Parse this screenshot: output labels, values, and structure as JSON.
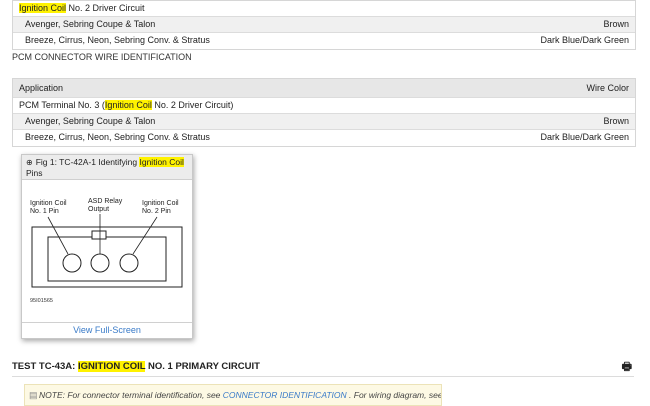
{
  "table1": {
    "top_row": {
      "pre": "",
      "highlight": "Ignition Coil",
      "post": " No. 2 Driver Circuit"
    },
    "rows": [
      {
        "label": "Avenger, Sebring Coupe & Talon",
        "value": "Brown"
      },
      {
        "label": "Breeze, Cirrus, Neon, Sebring Conv. & Stratus",
        "value": "Dark Blue/Dark Green"
      }
    ]
  },
  "section_label": "PCM CONNECTOR WIRE IDENTIFICATION",
  "table2": {
    "header_left": "Application",
    "header_right": "Wire Color",
    "group_row": {
      "pre": "PCM Terminal No. 3 (",
      "highlight": "Ignition Coil",
      "post": " No. 2 Driver Circuit)"
    },
    "rows": [
      {
        "label": "Avenger, Sebring Coupe & Talon",
        "value": "Brown"
      },
      {
        "label": "Breeze, Cirrus, Neon, Sebring Conv. & Stratus",
        "value": "Dark Blue/Dark Green"
      }
    ]
  },
  "figure": {
    "title_pre": "Fig 1: TC-42A-1 Identifying ",
    "title_highlight": "Ignition Coil",
    "title_post": "Pins",
    "label_left_1": "Ignition Coil",
    "label_left_2": "No. 1 Pin",
    "label_mid_1": "ASD Relay",
    "label_mid_2": "Output",
    "label_right_1": "Ignition Coil",
    "label_right_2": "No. 2 Pin",
    "code": "95I01565",
    "link": "View Full-Screen",
    "icon": "magnifier-plus-icon"
  },
  "test": {
    "pre": "TEST TC-43A: ",
    "highlight": "IGNITION COIL",
    "post": " NO. 1 PRIMARY CIRCUIT",
    "print_icon": "printer-icon"
  },
  "note": {
    "icon": "note-icon",
    "text_pre": "NOTE: For connector terminal identification, see ",
    "link": "CONNECTOR IDENTIFICATION",
    "text_post": " . For wiring diagram, see"
  }
}
